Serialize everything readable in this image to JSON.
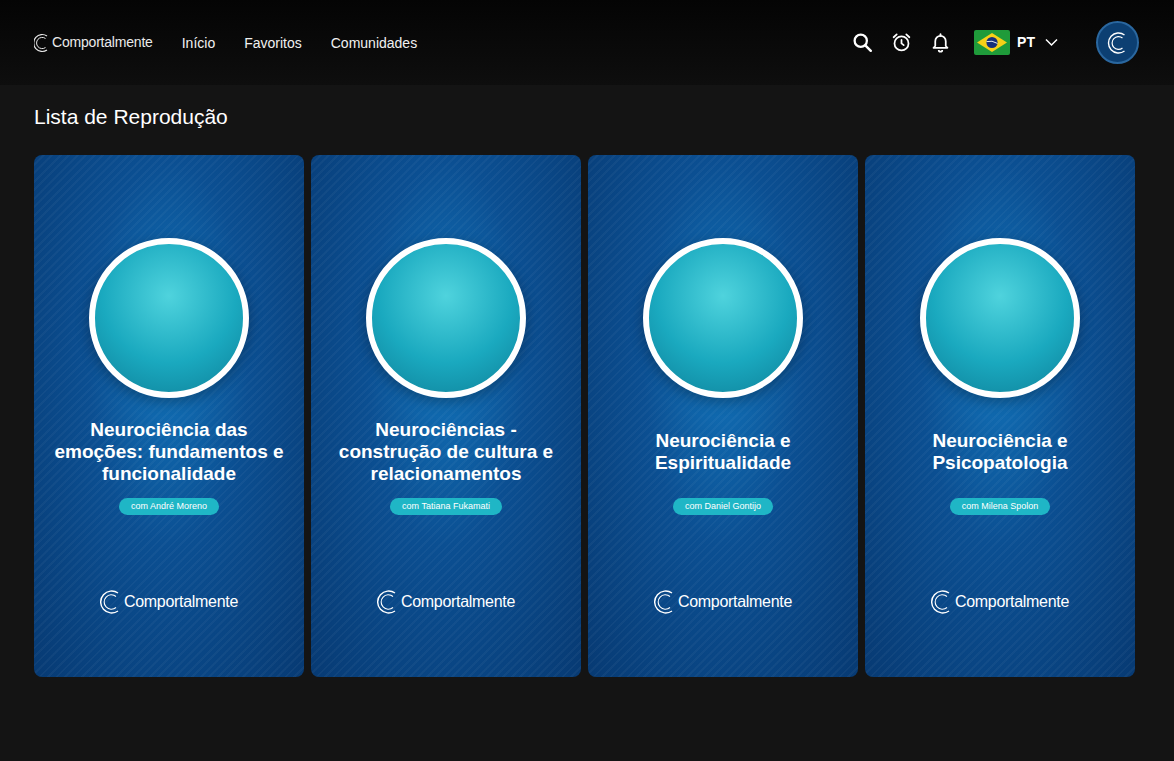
{
  "header": {
    "logo": "Comportalmente",
    "nav": [
      {
        "label": "Início",
        "selected": false
      },
      {
        "label": "Favoritos",
        "selected": false
      },
      {
        "label": "Comunidades",
        "selected": false
      }
    ],
    "language": "PT"
  },
  "playlist": {
    "title": "Lista de Reprodução",
    "items": [
      {
        "title": "Neurociência das emoções: fundamentos e funcionalidade",
        "host": "com André Moreno",
        "brand": "Comportalmente"
      },
      {
        "title": "Neurociências - construção de cultura e relacionamentos",
        "host": "com Tatiana Fukamati",
        "brand": "Comportalmente"
      },
      {
        "title": "Neurociência e Espiritualidade",
        "host": "com Daniel Gontijo",
        "brand": "Comportalmente"
      },
      {
        "title": "Neurociência e Psicopatologia",
        "host": "com Milena Spolon",
        "brand": "Comportalmente"
      }
    ]
  }
}
